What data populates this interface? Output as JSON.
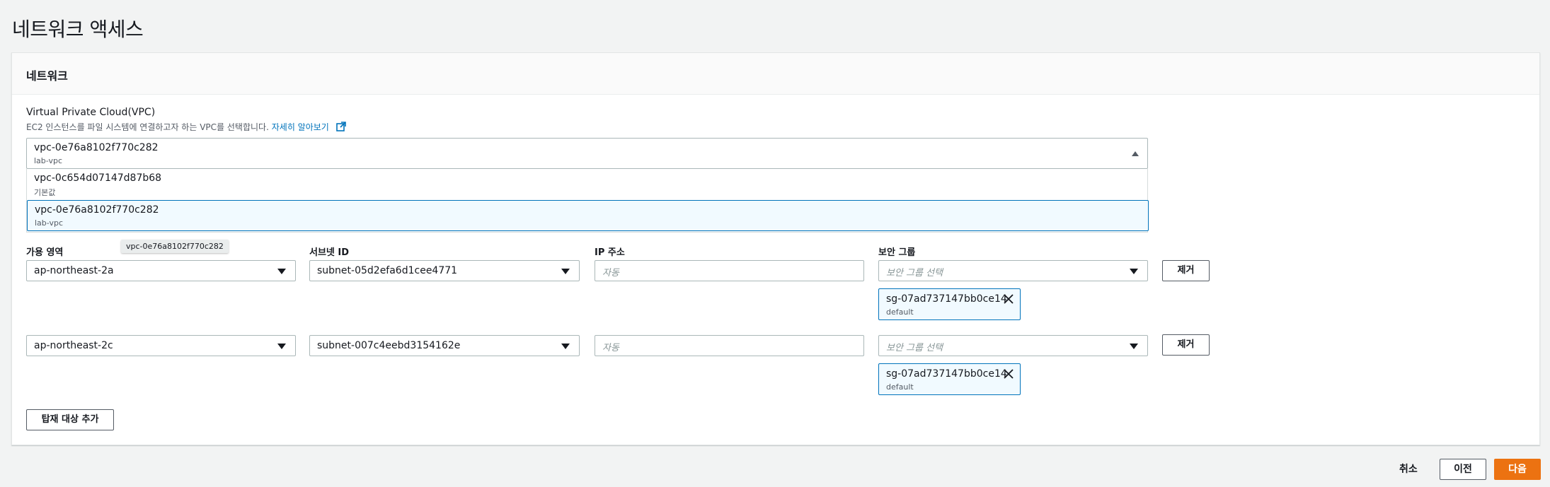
{
  "page": {
    "title": "네트워크 액세스"
  },
  "panel": {
    "title": "네트워크"
  },
  "vpc": {
    "label": "Virtual Private Cloud(VPC)",
    "description": "EC2 인스턴스를 파일 시스템에 연결하고자 하는 VPC를 선택합니다.",
    "learn_more": "자세히 알아보기",
    "selected": {
      "id": "vpc-0e76a8102f770c282",
      "name": "lab-vpc"
    },
    "options": [
      {
        "id": "vpc-0c654d07147d87b68",
        "name": "기본값"
      },
      {
        "id": "vpc-0e76a8102f770c282",
        "name": "lab-vpc"
      }
    ],
    "tooltip": "vpc-0e76a8102f770c282"
  },
  "columns": {
    "az": "가용 영역",
    "subnet": "서브넷 ID",
    "ip": "IP 주소",
    "sg": "보안 그룹"
  },
  "mount_targets": [
    {
      "az": "ap-northeast-2a",
      "subnet": "subnet-05d2efa6d1cee4771",
      "ip_placeholder": "자동",
      "sg_placeholder": "보안 그룹 선택",
      "remove_label": "제거",
      "sg_token": {
        "id": "sg-07ad737147bb0ce14",
        "name": "default"
      }
    },
    {
      "az": "ap-northeast-2c",
      "subnet": "subnet-007c4eebd3154162e",
      "ip_placeholder": "자동",
      "sg_placeholder": "보안 그룹 선택",
      "remove_label": "제거",
      "sg_token": {
        "id": "sg-07ad737147bb0ce14",
        "name": "default"
      }
    }
  ],
  "add_mount_target_label": "탑재 대상 추가",
  "footer": {
    "cancel": "취소",
    "previous": "이전",
    "next": "다음"
  },
  "colors": {
    "accent": "#0073bb",
    "primary": "#ec7211",
    "token_bg": "#f1faff"
  },
  "icons": {
    "external_link": "external-link-icon",
    "caret_down": "caret-down-icon",
    "caret_up": "caret-up-icon",
    "close": "close-icon"
  }
}
